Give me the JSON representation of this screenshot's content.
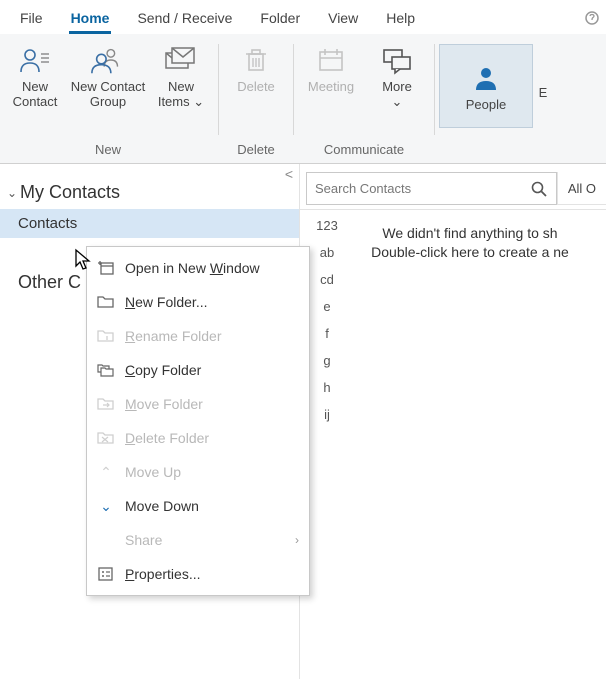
{
  "tabs": {
    "file": "File",
    "home": "Home",
    "send_receive": "Send / Receive",
    "folder": "Folder",
    "view": "View",
    "help": "Help"
  },
  "ribbon": {
    "new_contact": "New\nContact",
    "new_contact_group": "New Contact\nGroup",
    "new_items": "New\nItems",
    "new_items_dd": "⌄",
    "delete": "Delete",
    "meeting": "Meeting",
    "more": "More",
    "more_dd": "⌄",
    "people": "People",
    "right_trunc": "E",
    "group_new": "New",
    "group_delete": "Delete",
    "group_communicate": "Communicate"
  },
  "nav": {
    "header": "My Contacts",
    "item_contacts": "Contacts",
    "item_other": "Other C"
  },
  "alpha": [
    "123",
    "ab",
    "cd",
    "e",
    "f",
    "g",
    "h",
    "ij"
  ],
  "search": {
    "placeholder": "Search Contacts",
    "scope": "All O"
  },
  "empty": {
    "line1": "We didn't find anything to sh",
    "line2": "Double-click here to create a ne"
  },
  "ctx": {
    "open_new_window_pre": "Open in New ",
    "open_new_window_u": "W",
    "open_new_window_post": "indow",
    "new_folder_u": "N",
    "new_folder_post": "ew Folder...",
    "rename_u": "R",
    "rename_post": "ename Folder",
    "copy_u": "C",
    "copy_post": "opy Folder",
    "move_u": "M",
    "move_post": "ove Folder",
    "delete_u": "D",
    "delete_post": "elete Folder",
    "move_up": "Move Up",
    "move_down": "Move Down",
    "share": "Share",
    "properties_u": "P",
    "properties_post": "roperties..."
  }
}
